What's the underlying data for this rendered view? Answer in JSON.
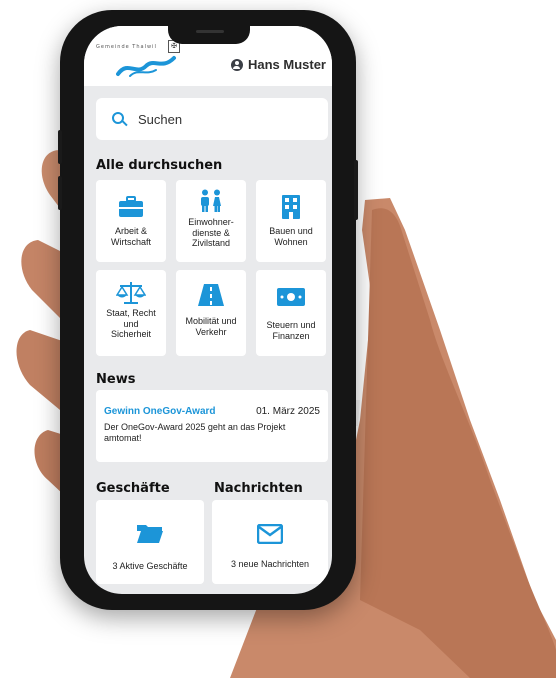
{
  "header": {
    "logo_text": "Gemeinde Thalwil",
    "user_name": "Hans Muster"
  },
  "search": {
    "placeholder": "Suchen"
  },
  "categories": {
    "title": "Alle durchsuchen",
    "items": [
      {
        "label": "Arbeit & Wirtschaft",
        "icon": "briefcase-icon"
      },
      {
        "label": "Einwohner-dienste & Zivilstand",
        "icon": "people-icon"
      },
      {
        "label": "Bauen und Wohnen",
        "icon": "building-icon"
      },
      {
        "label": "Staat, Recht und Sicherheit",
        "icon": "scales-icon"
      },
      {
        "label": "Mobilität und Verkehr",
        "icon": "road-icon"
      },
      {
        "label": "Steuern und Finanzen",
        "icon": "banknote-icon"
      }
    ]
  },
  "news": {
    "title": "News",
    "item": {
      "headline": "Gewinn OneGov-Award",
      "date": "01. März 2025",
      "body": "Der OneGov-Award 2025 geht an das Projekt amtomat!"
    }
  },
  "business": {
    "title": "Geschäfte",
    "label": "3 Aktive Geschäfte"
  },
  "messages": {
    "title": "Nachrichten",
    "label": "3 neue Nachrichten"
  },
  "colors": {
    "accent": "#1c95d8",
    "background": "#e9eaec",
    "card": "#ffffff"
  }
}
